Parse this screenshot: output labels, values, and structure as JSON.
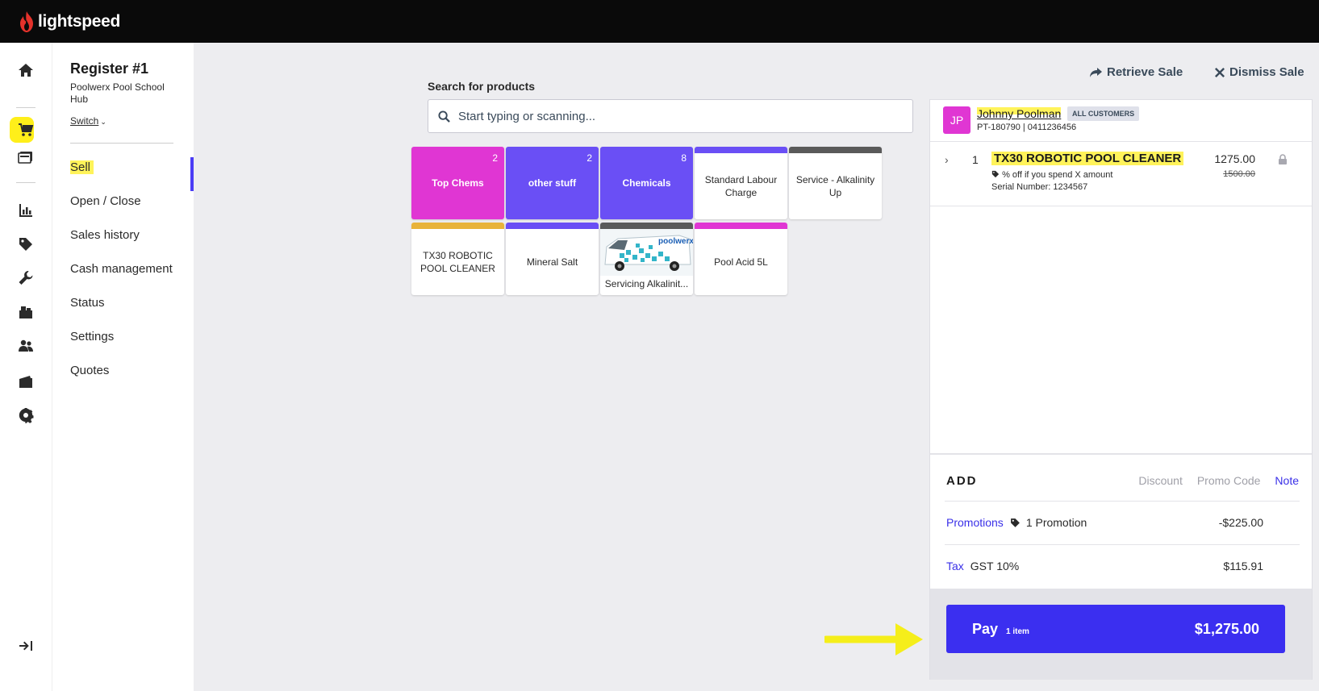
{
  "brand": {
    "name": "lightspeed"
  },
  "register": {
    "title": "Register #1",
    "outlet": "Poolwerx Pool School Hub",
    "switch_label": "Switch"
  },
  "rail_icons": [
    "home-icon",
    "sell-cart-icon",
    "register-icon",
    "reports-icon",
    "tag-icon",
    "wrench-icon",
    "inventory-icon",
    "customers-icon",
    "wallet-icon",
    "settings-gear-icon",
    "collapse-icon"
  ],
  "nav": {
    "items": [
      "Sell",
      "Open / Close",
      "Sales history",
      "Cash management",
      "Status",
      "Settings",
      "Quotes"
    ],
    "active": "Sell"
  },
  "top_actions": {
    "retrieve": "Retrieve Sale",
    "dismiss": "Dismiss Sale"
  },
  "search": {
    "label": "Search for products",
    "placeholder": "Start typing or scanning..."
  },
  "tiles": [
    {
      "label": "Top Chems",
      "count": "2",
      "color": "#e036d3",
      "type": "category"
    },
    {
      "label": "other stuff",
      "count": "2",
      "color": "#6a4ff5",
      "type": "category"
    },
    {
      "label": "Chemicals",
      "count": "8",
      "color": "#6a4ff5",
      "type": "category"
    },
    {
      "label": "Standard Labour Charge",
      "color": "#6a4ff5",
      "type": "product"
    },
    {
      "label": "Service - Alkalinity Up",
      "color": "#5a5a5a",
      "type": "product"
    },
    {
      "label": "TX30 ROBOTIC POOL CLEANER",
      "color": "#e8b33a",
      "type": "product"
    },
    {
      "label": "Mineral Salt",
      "color": "#6a4ff5",
      "type": "product"
    },
    {
      "label": "Servicing Alkalinit...",
      "color": "#5a5a5a",
      "type": "image",
      "image_text": "poolwerx"
    },
    {
      "label": "Pool Acid 5L",
      "color": "#e036d3",
      "type": "product"
    }
  ],
  "customer": {
    "initials": "JP",
    "name": "Johnny Poolman",
    "group": "ALL CUSTOMERS",
    "meta": "PT-180790 | 0411236456"
  },
  "line_item": {
    "qty": "1",
    "name": "TX30 ROBOTIC POOL CLEANER",
    "promo": "% off if you spend X amount",
    "serial": "Serial Number: 1234567",
    "price": "1275.00",
    "original_price": "1500.00"
  },
  "add": {
    "label": "ADD",
    "discount": "Discount",
    "promo_code": "Promo Code",
    "note": "Note"
  },
  "promotions": {
    "label": "Promotions",
    "count_text": "1 Promotion",
    "amount": "-$225.00"
  },
  "tax": {
    "label": "Tax",
    "name": "GST 10%",
    "amount": "$115.91"
  },
  "pay": {
    "label": "Pay",
    "items": "1 item",
    "total": "$1,275.00"
  },
  "colors": {
    "accent": "#3b2ff0",
    "highlight": "#fff35a",
    "annotation_arrow": "#f5ee1a"
  }
}
